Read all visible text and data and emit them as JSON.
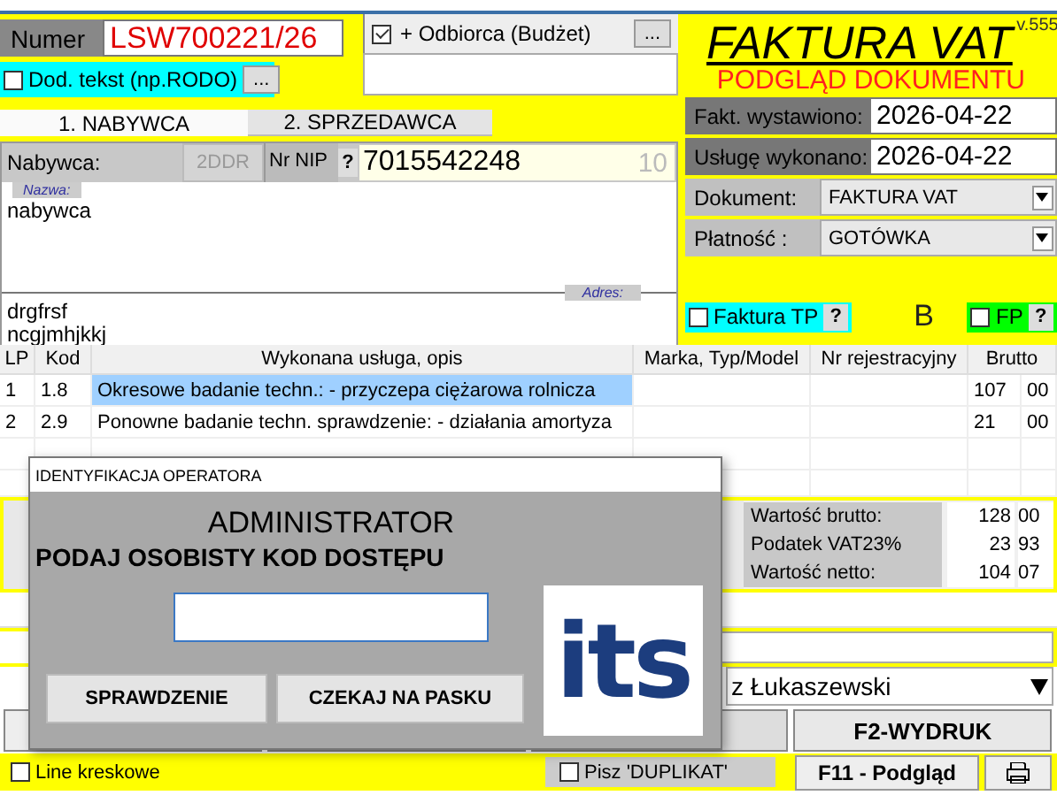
{
  "header": {
    "number_label": "Numer",
    "number": "LSW700221/26",
    "extra_text": {
      "label": "Dod. tekst (np.RODO)",
      "checked": false,
      "button": "..."
    },
    "recipient": {
      "label": "+ Odbiorca (Budżet)",
      "checked": true,
      "button": "..."
    }
  },
  "tabs": [
    {
      "label": "1. NABYWCA",
      "selected": true
    },
    {
      "label": "2. SPRZEDAWCA",
      "selected": false
    }
  ],
  "buyer": {
    "label": "Nabywca:",
    "name_label": "Nazwa:",
    "button_2ddr": {
      "label": "2DDR",
      "disabled": true
    },
    "nip_label": "Nr NIP",
    "nip_help": "?",
    "nip": "7015542248",
    "nip_length": "10",
    "name": "nabywca",
    "address_label": "Adres:",
    "address_lines": [
      "drgfrsf",
      "ncgjmhjkkj"
    ]
  },
  "document": {
    "version": "v.555",
    "title": "FAKTURA VAT",
    "subtitle": "PODGLĄD DOKUMENTU",
    "fields": [
      {
        "label": "Fakt. wystawiono:",
        "value": "2026-04-22",
        "kind": "date"
      },
      {
        "label": "Usługę wykonano:",
        "value": "2026-04-22",
        "kind": "date"
      },
      {
        "label": "Dokument:",
        "value": "FAKTURA VAT",
        "kind": "select"
      },
      {
        "label": "Płatność :",
        "value": "GOTÓWKA",
        "kind": "select"
      }
    ],
    "flags": [
      {
        "label": "Faktura TP",
        "checked": false,
        "help": "?",
        "color": "#00ffff"
      },
      {
        "label": "FP",
        "checked": false,
        "help": "?",
        "color": "#00ff00"
      }
    ],
    "marker": "B"
  },
  "table": {
    "columns": [
      "LP",
      "Kod",
      "Wykonana usługa, opis",
      "Marka, Typ/Model",
      "Nr rejestracyjny",
      "Brutto"
    ],
    "rows": [
      {
        "lp": "1",
        "code": "1.8",
        "description": "Okresowe badanie techn.: - przyczepa ciężarowa rolnicza",
        "model": "",
        "registration": "",
        "gross": "107",
        "gross_fraction": "00",
        "selected": true
      },
      {
        "lp": "2",
        "code": "2.9",
        "description": "Ponowne badanie techn. sprawdzenie: - działania amortyza",
        "model": "",
        "registration": "",
        "gross": "21",
        "gross_fraction": "00",
        "selected": false
      }
    ]
  },
  "totals": [
    {
      "label": "Wartość brutto:",
      "whole": "128",
      "fraction": "00"
    },
    {
      "label": "Podatek VAT23%",
      "whole": "23",
      "fraction": "93"
    },
    {
      "label": "Wartość netto:",
      "whole": "104",
      "fraction": "07"
    }
  ],
  "operator": {
    "value": "z Łukaszewski"
  },
  "actions": [
    {
      "label": "F2-WYDRUK"
    }
  ],
  "footer": {
    "barcode_lines": {
      "label": "Line kreskowe",
      "checked": false
    },
    "duplicate": {
      "label": "Pisz 'DUPLIKAT'",
      "checked": false
    },
    "preview_button": "F11 - Podgląd"
  },
  "dialog": {
    "title": "IDENTYFIKACJA OPERATORA",
    "user": "ADMINISTRATOR",
    "prompt": "PODAJ OSOBISTY KOD DOSTĘPU",
    "buttons": [
      "SPRAWDZENIE",
      "CZEKAJ NA PASKU"
    ],
    "logo": "its"
  }
}
